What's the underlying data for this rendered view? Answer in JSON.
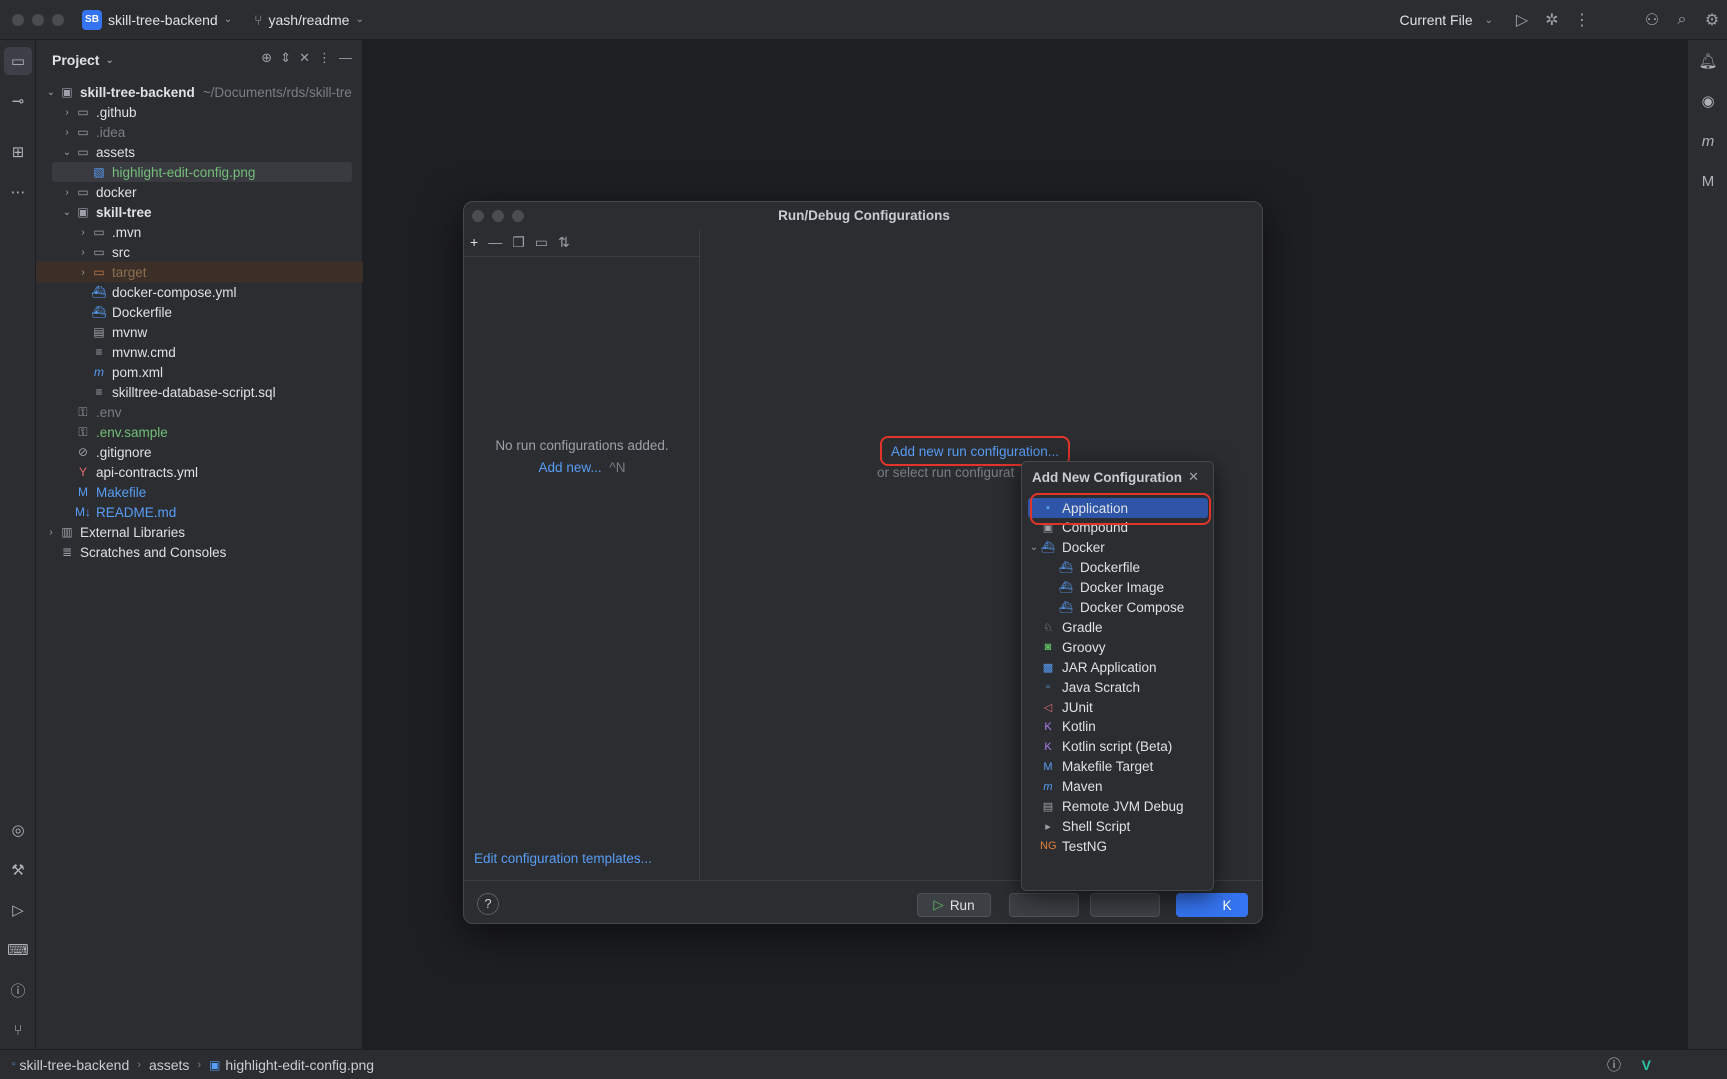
{
  "titlebar": {
    "project_badge": "SB",
    "project_name": "skill-tree-backend",
    "branch": "yash/readme",
    "run_target": "Current File"
  },
  "project_panel": {
    "title": "Project",
    "tree": [
      {
        "label": "skill-tree-backend",
        "hint": "~/Documents/rds/skill-tre",
        "icon": "module-folder-icon",
        "depth": 0,
        "expanded": true,
        "bold": true,
        "color": "#dfe1e5"
      },
      {
        "label": ".github",
        "icon": "folder-icon",
        "depth": 1,
        "collapsed": true,
        "color": "#dfe1e5"
      },
      {
        "label": ".idea",
        "icon": "folder-icon",
        "depth": 1,
        "collapsed": true,
        "color": "#7a7e85"
      },
      {
        "label": "assets",
        "icon": "folder-icon",
        "depth": 1,
        "expanded": true,
        "color": "#dfe1e5"
      },
      {
        "label": "highlight-edit-config.png",
        "icon": "image-file-icon",
        "depth": 2,
        "color": "#73bd79",
        "selected": true
      },
      {
        "label": "docker",
        "icon": "folder-icon",
        "depth": 1,
        "collapsed": true,
        "color": "#dfe1e5"
      },
      {
        "label": "skill-tree",
        "icon": "module-folder-icon",
        "depth": 1,
        "expanded": true,
        "bold": true,
        "color": "#dfe1e5"
      },
      {
        "label": ".mvn",
        "icon": "folder-icon",
        "depth": 2,
        "collapsed": true,
        "color": "#dfe1e5"
      },
      {
        "label": "src",
        "icon": "folder-icon",
        "depth": 2,
        "collapsed": true,
        "color": "#dfe1e5"
      },
      {
        "label": "target",
        "icon": "excluded-folder-icon",
        "depth": 2,
        "collapsed": true,
        "color": "#8c6d4f",
        "excluded": true
      },
      {
        "label": "docker-compose.yml",
        "icon": "docker-icon",
        "depth": 2,
        "color": "#dfe1e5"
      },
      {
        "label": "Dockerfile",
        "icon": "docker-icon",
        "depth": 2,
        "color": "#dfe1e5"
      },
      {
        "label": "mvnw",
        "icon": "terminal-file-icon",
        "depth": 2,
        "color": "#dfe1e5"
      },
      {
        "label": "mvnw.cmd",
        "icon": "text-file-icon",
        "depth": 2,
        "color": "#dfe1e5"
      },
      {
        "label": "pom.xml",
        "icon": "maven-icon",
        "depth": 2,
        "color": "#dfe1e5"
      },
      {
        "label": "skilltree-database-script.sql",
        "icon": "text-file-icon",
        "depth": 2,
        "color": "#dfe1e5"
      },
      {
        "label": ".env",
        "icon": "env-file-icon",
        "depth": 1,
        "color": "#7a7e85"
      },
      {
        "label": ".env.sample",
        "icon": "env-file-icon",
        "depth": 1,
        "color": "#73bd79"
      },
      {
        "label": ".gitignore",
        "icon": "ignore-file-icon",
        "depth": 1,
        "color": "#dfe1e5"
      },
      {
        "label": "api-contracts.yml",
        "icon": "yaml-icon",
        "depth": 1,
        "color": "#dfe1e5"
      },
      {
        "label": "Makefile",
        "icon": "makefile-icon",
        "depth": 1,
        "color": "#589df6"
      },
      {
        "label": "README.md",
        "icon": "markdown-icon",
        "depth": 1,
        "color": "#589df6"
      },
      {
        "label": "External Libraries",
        "icon": "libraries-icon",
        "depth": 0,
        "collapsed": true,
        "color": "#dfe1e5"
      },
      {
        "label": "Scratches and Consoles",
        "icon": "scratches-icon",
        "depth": 0,
        "color": "#dfe1e5"
      }
    ]
  },
  "dialog": {
    "title": "Run/Debug Configurations",
    "empty_text": "No run configurations added.",
    "add_new_label": "Add new...",
    "add_new_shortcut": "^N",
    "add_run_config_link": "Add new run configuration...",
    "select_text": "or select run configurat",
    "edit_templates_link": "Edit configuration templates...",
    "help_label": "?",
    "run_button": "Run",
    "ok_button": "K"
  },
  "popup": {
    "title": "Add New Configuration",
    "items": [
      {
        "label": "Application",
        "icon": "application-icon",
        "indent": 0,
        "selected": true,
        "icon_color": "#589df6"
      },
      {
        "label": "Compound",
        "icon": "compound-icon",
        "indent": 0,
        "icon_color": "#9da0a8"
      },
      {
        "label": "Docker",
        "icon": "docker-icon",
        "indent": 0,
        "expanded": true,
        "icon_color": "#589df6"
      },
      {
        "label": "Dockerfile",
        "icon": "docker-icon",
        "indent": 1,
        "icon_color": "#589df6"
      },
      {
        "label": "Docker Image",
        "icon": "docker-icon",
        "indent": 1,
        "icon_color": "#589df6"
      },
      {
        "label": "Docker Compose",
        "icon": "docker-icon",
        "indent": 1,
        "icon_color": "#589df6"
      },
      {
        "label": "Gradle",
        "icon": "gradle-icon",
        "indent": 0,
        "icon_color": "#9da0a8"
      },
      {
        "label": "Groovy",
        "icon": "groovy-icon",
        "indent": 0,
        "icon_color": "#5fb85f"
      },
      {
        "label": "JAR Application",
        "icon": "jar-icon",
        "indent": 0,
        "icon_color": "#589df6"
      },
      {
        "label": "Java Scratch",
        "icon": "java-scratch-icon",
        "indent": 0,
        "icon_color": "#589df6"
      },
      {
        "label": "JUnit",
        "icon": "junit-icon",
        "indent": 0,
        "icon_color": "#e06c75"
      },
      {
        "label": "Kotlin",
        "icon": "kotlin-icon",
        "indent": 0,
        "icon_color": "#b07cf0"
      },
      {
        "label": "Kotlin script (Beta)",
        "icon": "kotlin-icon",
        "indent": 0,
        "icon_color": "#b07cf0"
      },
      {
        "label": "Makefile Target",
        "icon": "makefile-icon",
        "indent": 0,
        "icon_color": "#589df6"
      },
      {
        "label": "Maven",
        "icon": "maven-icon",
        "indent": 0,
        "icon_color": "#589df6"
      },
      {
        "label": "Remote JVM Debug",
        "icon": "remote-debug-icon",
        "indent": 0,
        "icon_color": "#9da0a8"
      },
      {
        "label": "Shell Script",
        "icon": "shell-script-icon",
        "indent": 0,
        "icon_color": "#9da0a8"
      },
      {
        "label": "TestNG",
        "icon": "testng-icon",
        "indent": 0,
        "icon_color": "#e0803b"
      }
    ]
  },
  "statusbar": {
    "crumbs": [
      "skill-tree-backend",
      "assets",
      "highlight-edit-config.png"
    ]
  }
}
